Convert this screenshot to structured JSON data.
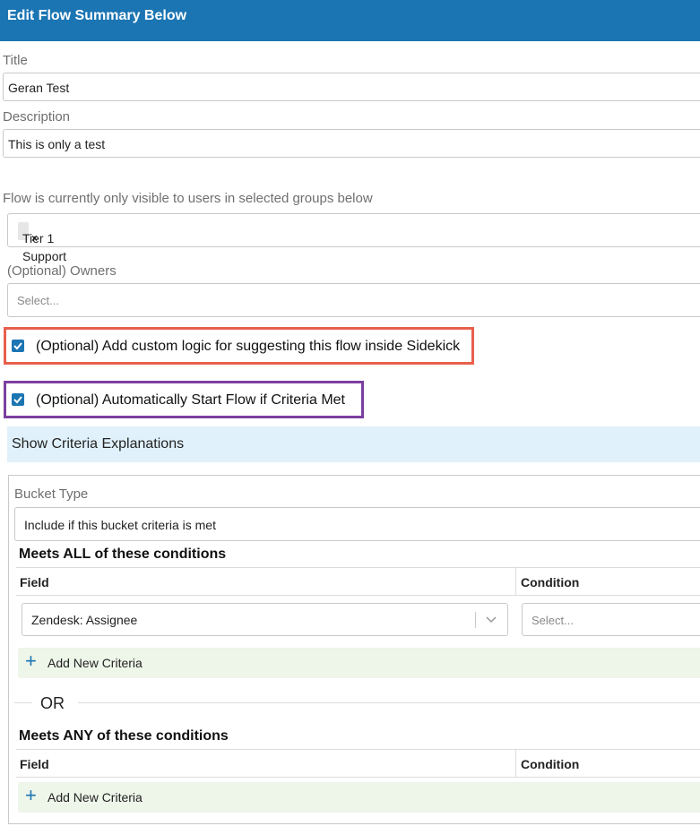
{
  "header": {
    "title": "Edit Flow Summary Below"
  },
  "title_field": {
    "label": "Title",
    "value": "Geran Test"
  },
  "description_field": {
    "label": "Description",
    "value": "This is only a test"
  },
  "groups": {
    "label": "Flow is currently only visible to users in selected groups below",
    "tags": [
      {
        "label": "Tier 1 Support",
        "remove": "×"
      }
    ]
  },
  "owners": {
    "label": "(Optional) Owners",
    "placeholder": "Select..."
  },
  "custom_logic": {
    "label": "(Optional) Add custom logic for suggesting this flow inside Sidekick",
    "checked": true,
    "highlight": "#e8604c"
  },
  "auto_start": {
    "label": "(Optional) Automatically Start Flow if Criteria Met",
    "checked": true,
    "highlight": "#7b3fa0"
  },
  "criteria_explanations": {
    "label": "Show Criteria Explanations"
  },
  "bucket": {
    "type_label": "Bucket Type",
    "type_value": "Include if this bucket criteria is met",
    "all_section": {
      "heading": "Meets ALL of these conditions",
      "columns": [
        "Field",
        "Condition"
      ],
      "rows": [
        {
          "field": "Zendesk: Assignee",
          "condition_placeholder": "Select..."
        }
      ],
      "add_label": "Add New Criteria"
    },
    "or_label": "OR",
    "any_section": {
      "heading": "Meets ANY of these conditions",
      "columns": [
        "Field",
        "Condition"
      ],
      "add_label": "Add New Criteria"
    }
  },
  "colors": {
    "header": "#1b75b3",
    "accent": "#1b75b3",
    "criteria_bar": "#e0f1fb",
    "add_row": "#eef5e9"
  }
}
